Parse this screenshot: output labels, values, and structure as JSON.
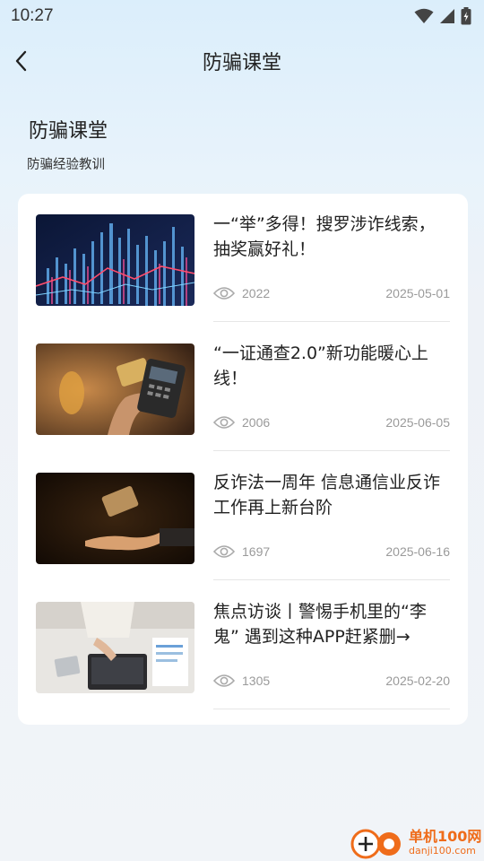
{
  "status_bar": {
    "time": "10:27",
    "icons": [
      "wifi-icon",
      "signal-icon",
      "battery-icon"
    ]
  },
  "nav": {
    "back_icon": "chevron-left-icon",
    "title": "防骗课堂"
  },
  "section": {
    "title": "防骗课堂",
    "subtitle": "防骗经验教训"
  },
  "articles": [
    {
      "title": "一“举”多得！搜罗涉诈线索，抽奖赢好礼！",
      "views": "2022",
      "date": "2025-05-01"
    },
    {
      "title": "“一证通查2.0”新功能暖心上线！",
      "views": "2006",
      "date": "2025-06-05"
    },
    {
      "title": "反诈法一周年 信息通信业反诈工作再上新台阶",
      "views": "1697",
      "date": "2025-06-16"
    },
    {
      "title": "焦点访谈丨警惕手机里的“李鬼” 遇到这种APP赶紧删→",
      "views": "1305",
      "date": "2025-02-20"
    }
  ],
  "watermark": {
    "name": "单机100网",
    "url": "danji100.com"
  },
  "colors": {
    "accent": "#ef6c1a",
    "meta_text": "#9a9a9a",
    "card_bg": "#ffffff"
  }
}
